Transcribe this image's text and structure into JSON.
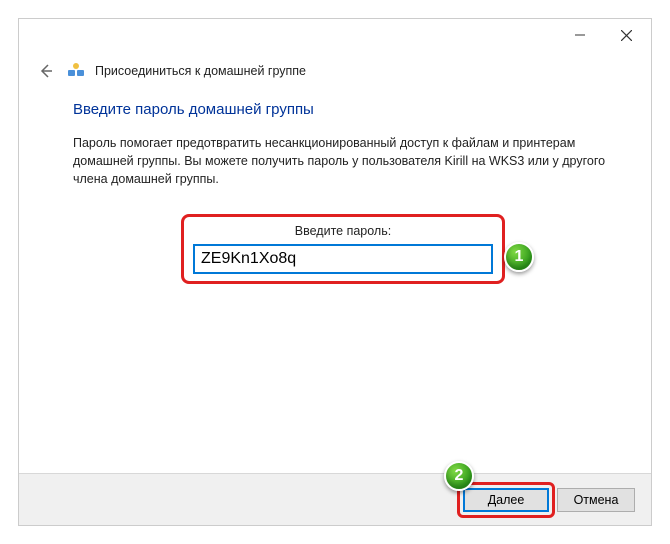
{
  "window": {
    "title": "Присоединиться к домашней группе"
  },
  "content": {
    "heading": "Введите пароль домашней группы",
    "description": "Пароль помогает предотвратить несанкционированный доступ к файлам и принтерам домашней группы. Вы можете получить пароль у пользователя Kirill на WKS3 или у другого члена домашней группы.",
    "password_label": "Введите пароль:",
    "password_value": "ZE9Kn1Xo8q"
  },
  "buttons": {
    "next": "Далее",
    "cancel": "Отмена"
  },
  "markers": {
    "one": "1",
    "two": "2"
  }
}
